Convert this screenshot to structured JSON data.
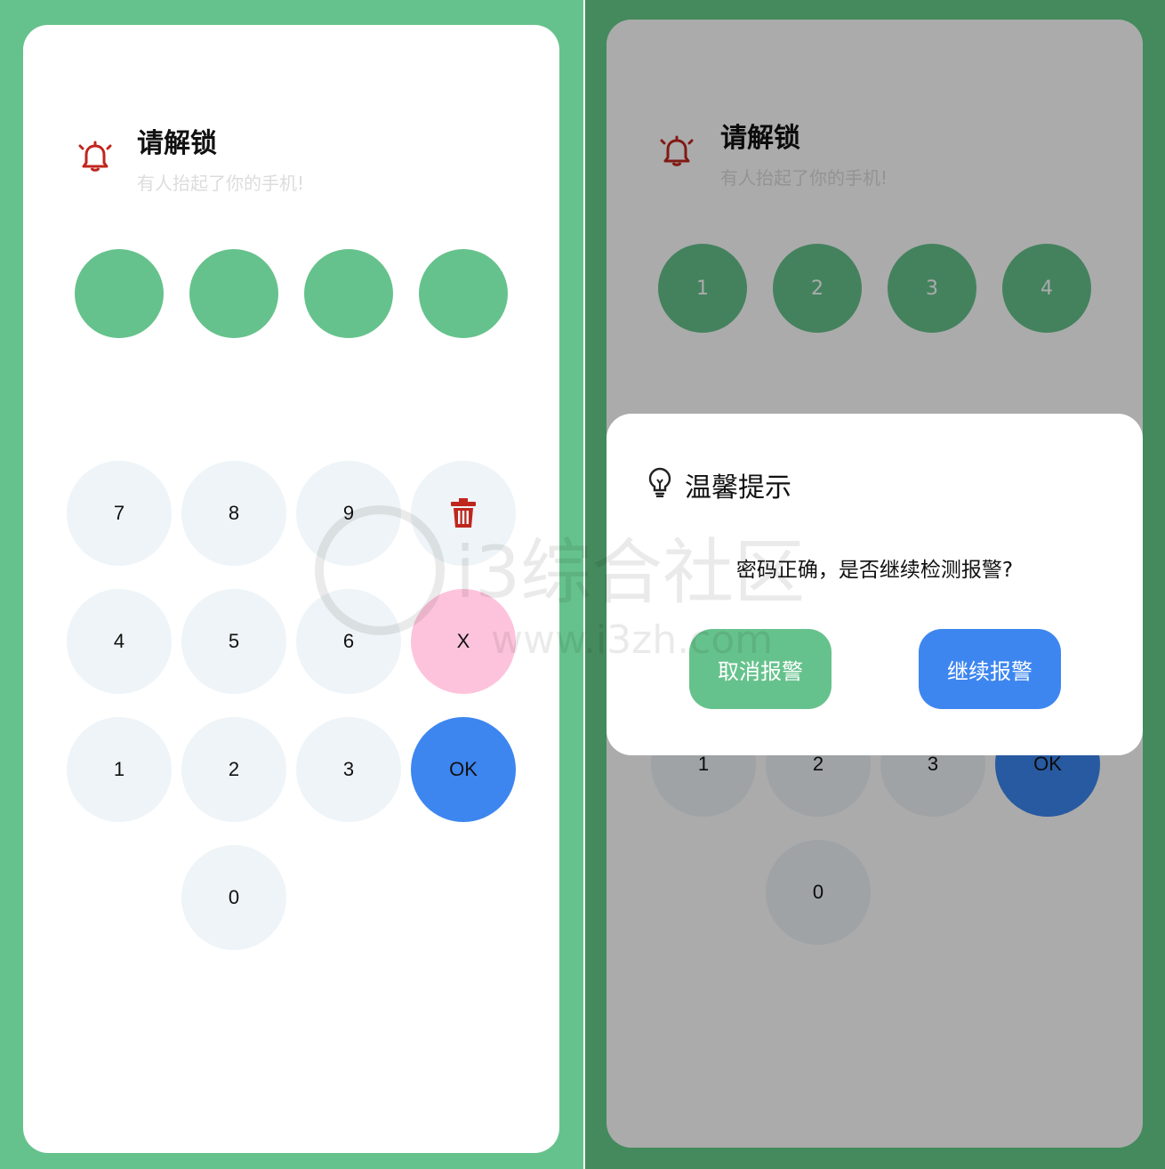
{
  "left": {
    "title": "请解锁",
    "subtitle": "有人抬起了你的手机!",
    "pins": [
      "",
      "",
      "",
      ""
    ],
    "keys": {
      "k7": "7",
      "k8": "8",
      "k9": "9",
      "k4": "4",
      "k5": "5",
      "k6": "6",
      "clear": "X",
      "k1": "1",
      "k2": "2",
      "k3": "3",
      "ok": "OK",
      "k0": "0"
    },
    "colors": {
      "accent": "#66c28c",
      "clear": "#fec3dc",
      "ok": "#3d86f0",
      "danger": "#c0261e"
    },
    "icons": {
      "bell": "bell-icon",
      "delete": "trash-icon"
    }
  },
  "right": {
    "title": "请解锁",
    "subtitle": "有人抬起了你的手机!",
    "pins": [
      "1",
      "2",
      "3",
      "4"
    ],
    "keys": {
      "k1": "1",
      "k2": "2",
      "k3": "3",
      "ok": "OK",
      "k0": "0"
    },
    "dialog": {
      "title": "温馨提示",
      "message": "密码正确，是否继续检测报警?",
      "cancel": "取消报警",
      "continue": "继续报警",
      "icon": "lightbulb-icon"
    }
  },
  "watermark": {
    "line1": "i3综合社区",
    "line2": "www.i3zh.com"
  }
}
